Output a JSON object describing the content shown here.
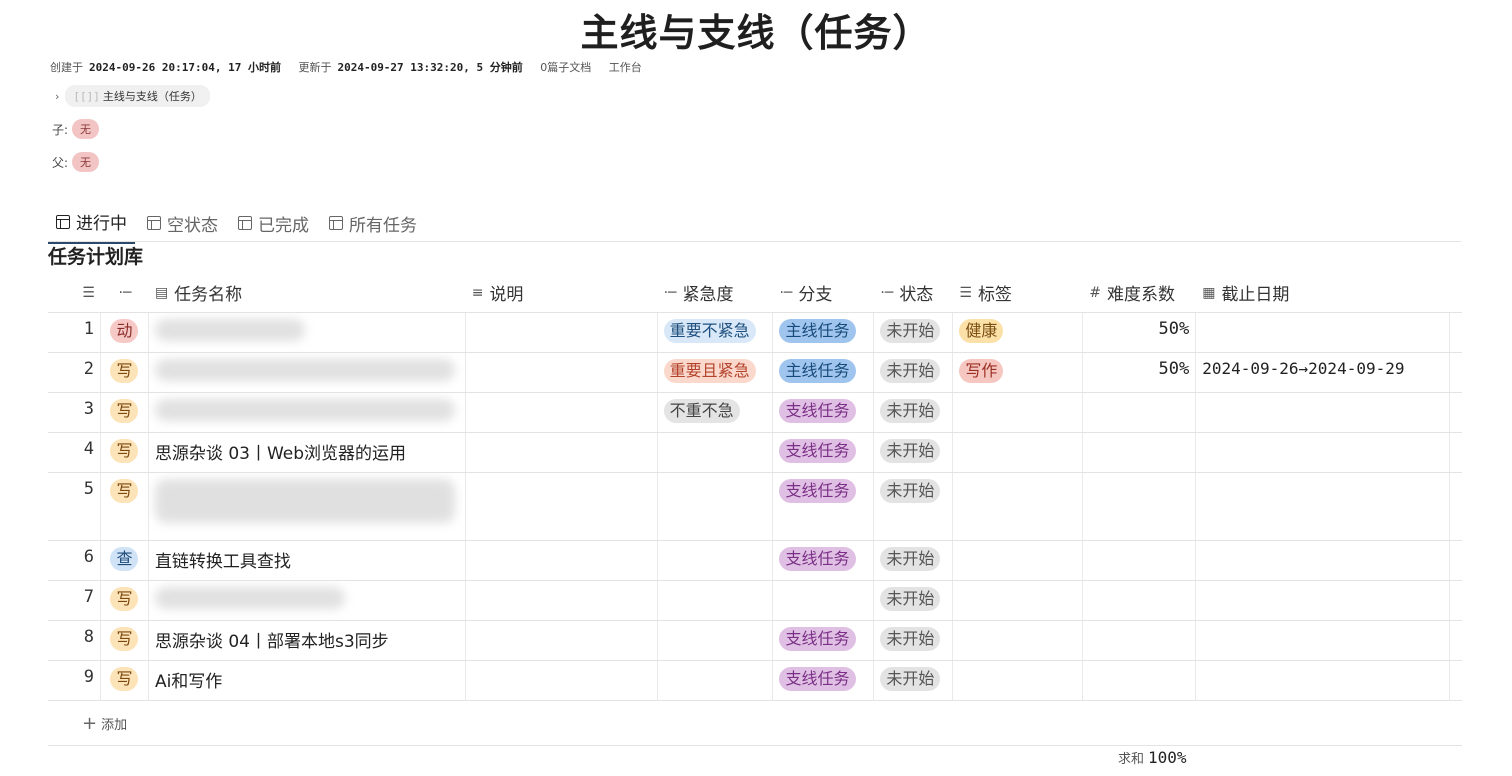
{
  "page": {
    "title": "主线与支线（任务）",
    "meta": {
      "created_label": "创建于",
      "created_value": "2024-09-26 20:17:04, 17 小时前",
      "updated_label": "更新于",
      "updated_value": "2024-09-27 13:32:20, 5 分钟前",
      "subdocs": "0篇子文档",
      "workspace": "工作台"
    },
    "breadcrumb": {
      "brackets": "[[]]",
      "label": "主线与支线（任务）"
    },
    "children": {
      "label": "子:",
      "value": "无"
    },
    "parent": {
      "label": "父:",
      "value": "无"
    }
  },
  "tabs": [
    {
      "label": "进行中",
      "active": true
    },
    {
      "label": "空状态"
    },
    {
      "label": "已完成"
    },
    {
      "label": "所有任务"
    }
  ],
  "database": {
    "title": "任务计划库",
    "columns": {
      "cat": "",
      "name": "任务名称",
      "desc": "说明",
      "urgency": "紧急度",
      "branch": "分支",
      "status": "状态",
      "tags": "标签",
      "difficulty": "难度系数",
      "due": "截止日期"
    },
    "rows": [
      {
        "n": "1",
        "cat": "动",
        "name": "",
        "urgency": "重要不紧急",
        "branch": "主线任务",
        "status": "未开始",
        "tag": "健康",
        "difficulty": "50%",
        "due": ""
      },
      {
        "n": "2",
        "cat": "写",
        "name": "",
        "urgency": "重要且紧急",
        "branch": "主线任务",
        "status": "未开始",
        "tag": "写作",
        "difficulty": "50%",
        "due": "2024-09-26→2024-09-29"
      },
      {
        "n": "3",
        "cat": "写",
        "name": "",
        "urgency": "不重不急",
        "branch": "支线任务",
        "status": "未开始",
        "tag": "",
        "difficulty": "",
        "due": ""
      },
      {
        "n": "4",
        "cat": "写",
        "name": "思源杂谈 03丨Web浏览器的运用",
        "urgency": "",
        "branch": "支线任务",
        "status": "未开始",
        "tag": "",
        "difficulty": "",
        "due": ""
      },
      {
        "n": "5",
        "cat": "写",
        "name": "",
        "urgency": "",
        "branch": "支线任务",
        "status": "未开始",
        "tag": "",
        "difficulty": "",
        "due": ""
      },
      {
        "n": "6",
        "cat": "查",
        "name": "直链转换工具查找",
        "urgency": "",
        "branch": "支线任务",
        "status": "未开始",
        "tag": "",
        "difficulty": "",
        "due": ""
      },
      {
        "n": "7",
        "cat": "写",
        "name": "",
        "urgency": "",
        "branch": "",
        "status": "未开始",
        "tag": "",
        "difficulty": "",
        "due": ""
      },
      {
        "n": "8",
        "cat": "写",
        "name": "思源杂谈 04丨部署本地s3同步",
        "urgency": "",
        "branch": "支线任务",
        "status": "未开始",
        "tag": "",
        "difficulty": "",
        "due": ""
      },
      {
        "n": "9",
        "cat": "写",
        "name": "Ai和写作",
        "urgency": "",
        "branch": "支线任务",
        "status": "未开始",
        "tag": "",
        "difficulty": "",
        "due": ""
      }
    ],
    "add_label": "添加",
    "sum_label": "求和",
    "sum_value": "100%"
  },
  "colors": {
    "accent": "#2b4a6b",
    "branch_main": "#9fc5ee",
    "branch_side": "#e0bfe4",
    "status_not_started": "#e3e3e3"
  }
}
